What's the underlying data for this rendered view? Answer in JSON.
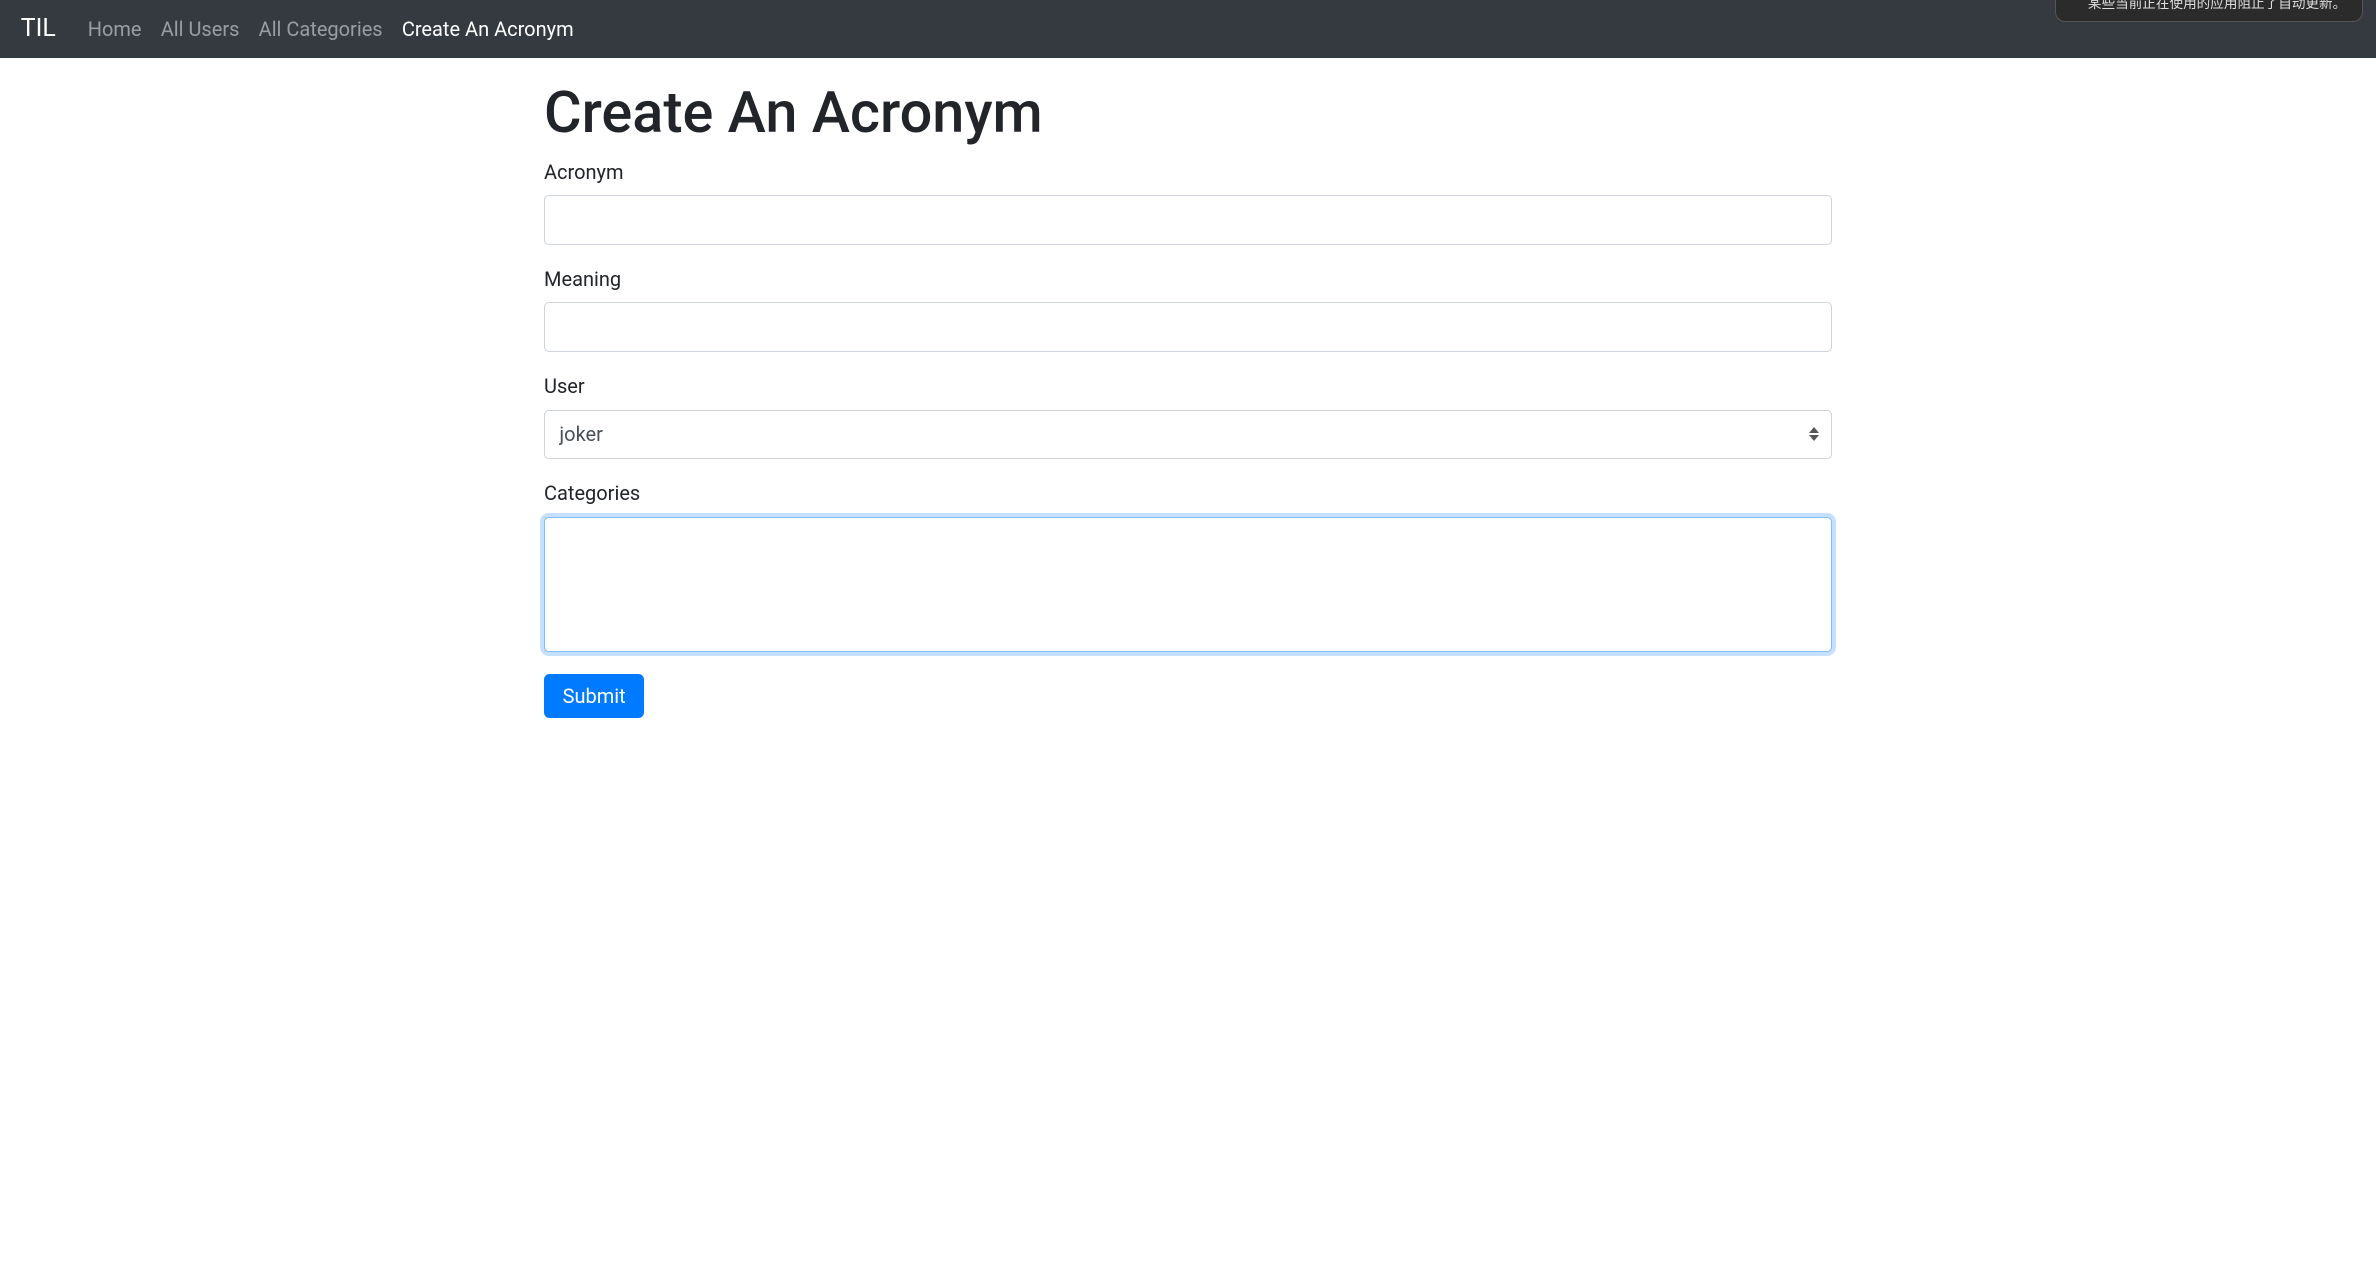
{
  "nav": {
    "brand": "TIL",
    "links": [
      {
        "label": "Home",
        "active": false
      },
      {
        "label": "All Users",
        "active": false
      },
      {
        "label": "All Categories",
        "active": false
      },
      {
        "label": "Create An Acronym",
        "active": true
      }
    ]
  },
  "notification": "某些当前正在使用的应用阻止了自动更新。",
  "page": {
    "title": "Create An Acronym"
  },
  "form": {
    "acronym": {
      "label": "Acronym",
      "value": ""
    },
    "meaning": {
      "label": "Meaning",
      "value": ""
    },
    "user": {
      "label": "User",
      "selected": "joker"
    },
    "categories": {
      "label": "Categories"
    },
    "submit": "Submit"
  }
}
